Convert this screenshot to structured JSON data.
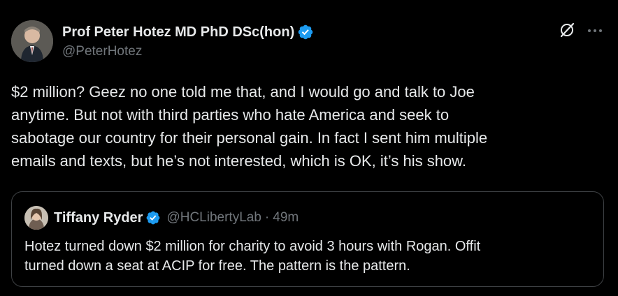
{
  "author": {
    "display_name": "Prof Peter Hotez MD PhD DSc(hon)",
    "handle": "@PeterHotez",
    "verified": true,
    "avatar_icon": "profile-photo"
  },
  "actions": {
    "grok_icon": "grok-icon",
    "more_icon": "more-icon",
    "more_label": "···"
  },
  "tweet": {
    "lines": [
      "$2 million? Geez no one told me that, and I would go and talk to Joe",
      "anytime. But not with third parties who hate America and seek to",
      "sabotage our country for their personal gain. In fact I sent him multiple",
      "emails and texts, but he’s not interested, which is OK, it’s his show."
    ]
  },
  "quote": {
    "display_name": "Tiffany Ryder",
    "handle": "@HCLibertyLab",
    "separator": "·",
    "time": "49m",
    "verified": true,
    "lines": [
      "Hotez turned down $2 million for charity to avoid 3 hours with Rogan. Offit",
      "turned down a seat at ACIP for free. The pattern is the pattern."
    ]
  },
  "colors": {
    "background": "#000000",
    "text_primary": "#e7e9ea",
    "text_secondary": "#71767b",
    "verified_blue": "#1d9bf0",
    "border": "#3e4144"
  }
}
